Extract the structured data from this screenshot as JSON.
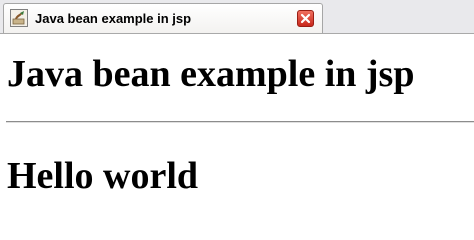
{
  "browser": {
    "tab": {
      "title": "Java bean example in jsp",
      "favicon_icon": "java-page-icon",
      "close_icon": "close-icon",
      "close_color": "#d8382a"
    }
  },
  "page": {
    "heading": "Java bean example in jsp",
    "message": "Hello world"
  }
}
